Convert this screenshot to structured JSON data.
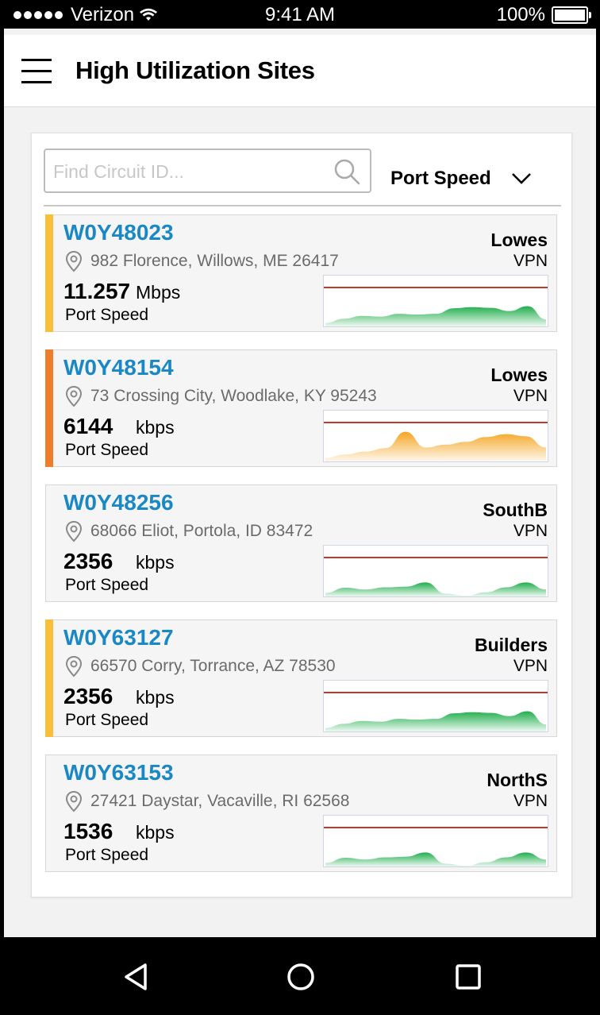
{
  "status_bar": {
    "carrier": "Verizon",
    "time": "9:41 AM",
    "battery": "100%"
  },
  "header": {
    "title": "High Utilization Sites",
    "menu_icon": "hamburger-menu-icon"
  },
  "search": {
    "placeholder": "Find Circuit ID...",
    "value": "",
    "icon": "search-icon"
  },
  "sort": {
    "selected": "Port Speed",
    "icon": "chevron-down-icon"
  },
  "colors": {
    "id_blue": "#1b88c6",
    "yellow_accent": "#f9bf3b",
    "orange_accent": "#ee7d2b",
    "green_fill": "#1fae4b",
    "orange_fill": "#f5a623",
    "threshold_line": "#c0392b"
  },
  "sites": [
    {
      "id": "W0Y48023",
      "address": "982 Florence, Willows, ME 26417",
      "customer": "Lowes",
      "service": "VPN",
      "speed": "11.257",
      "unit": "Mbps",
      "speed_label": "Port Speed",
      "accent": "yellow",
      "chart_color": "green",
      "profile": [
        0.1,
        0.22,
        0.3,
        0.28,
        0.36,
        0.34,
        0.36,
        0.52,
        0.55,
        0.53,
        0.44,
        0.58,
        0.2
      ]
    },
    {
      "id": "W0Y48154",
      "address": "73 Crossing City, Woodlake, KY 95243",
      "customer": "Lowes",
      "service": "VPN",
      "speed": "6144",
      "unit": "kbps",
      "speed_label": "Port Speed",
      "accent": "orange",
      "chart_color": "orange",
      "profile": [
        0.1,
        0.2,
        0.28,
        0.38,
        0.85,
        0.4,
        0.48,
        0.56,
        0.7,
        0.78,
        0.72,
        0.4
      ]
    },
    {
      "id": "W0Y48256",
      "address": "68066 Eliot, Portola, ID 83472",
      "customer": "SouthB",
      "service": "VPN",
      "speed": "2356",
      "unit": "kbps",
      "speed_label": "Port Speed",
      "accent": "none",
      "chart_color": "green",
      "profile": [
        0.1,
        0.25,
        0.2,
        0.26,
        0.28,
        0.4,
        0.08,
        0.02,
        0.12,
        0.26,
        0.4,
        0.2
      ]
    },
    {
      "id": "W0Y63127",
      "address": "66570 Corry, Torrance, AZ 78530",
      "customer": "Builders",
      "service": "VPN",
      "speed": "2356",
      "unit": "kbps",
      "speed_label": "Port Speed",
      "accent": "yellow",
      "chart_color": "green",
      "profile": [
        0.1,
        0.22,
        0.3,
        0.28,
        0.36,
        0.34,
        0.36,
        0.52,
        0.55,
        0.53,
        0.44,
        0.58,
        0.2
      ]
    },
    {
      "id": "W0Y63153",
      "address": "27421 Daystar, Vacaville, RI 62568",
      "customer": "NorthS",
      "service": "VPN",
      "speed": "1536",
      "unit": "kbps",
      "speed_label": "Port Speed",
      "accent": "none",
      "chart_color": "green",
      "profile": [
        0.1,
        0.25,
        0.2,
        0.26,
        0.28,
        0.4,
        0.08,
        0.02,
        0.12,
        0.26,
        0.4,
        0.2
      ]
    }
  ],
  "nav": {
    "back_icon": "back-triangle-icon",
    "home_icon": "home-circle-icon",
    "recents_icon": "recents-square-icon"
  }
}
